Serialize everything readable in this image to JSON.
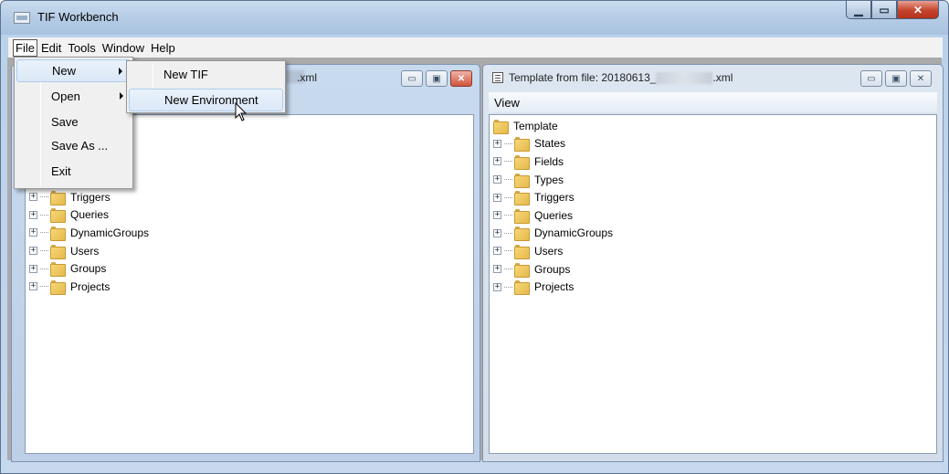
{
  "window": {
    "title": "TIF Workbench"
  },
  "menubar": [
    "File",
    "Edit",
    "Tools",
    "Window",
    "Help"
  ],
  "file_menu": [
    {
      "label": "New",
      "submenu": true
    },
    {
      "label": "Open",
      "submenu": true
    },
    {
      "label": "Save",
      "submenu": false
    },
    {
      "label": "Save As ...",
      "submenu": false
    },
    {
      "label": "Exit",
      "submenu": false
    }
  ],
  "new_submenu": [
    "New TIF",
    "New Environment"
  ],
  "left_child": {
    "title_suffix": ".xml",
    "tree": [
      "Triggers",
      "Queries",
      "DynamicGroups",
      "Users",
      "Groups",
      "Projects"
    ]
  },
  "right_child": {
    "title_prefix": "Template from file: 20180613_",
    "title_suffix": ".xml",
    "menu": "View",
    "root": "Template",
    "tree": [
      "States",
      "Fields",
      "Types",
      "Triggers",
      "Queries",
      "DynamicGroups",
      "Users",
      "Groups",
      "Projects"
    ]
  },
  "colors": {
    "highlight_border": "#aeccee",
    "folder": "#f7d778",
    "mdi_bg": "#abaaab"
  }
}
